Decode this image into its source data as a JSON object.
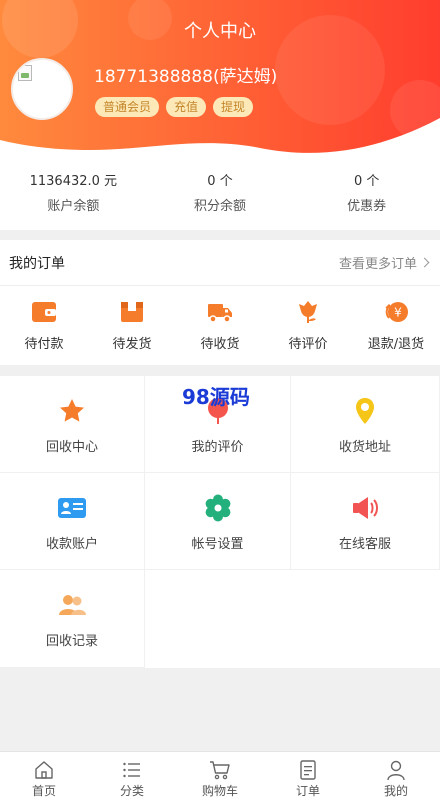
{
  "header": {
    "title": "个人中心",
    "username": "18771388888(萨达姆)",
    "badges": [
      {
        "label": "普通会员"
      },
      {
        "label": "充值"
      },
      {
        "label": "提现"
      }
    ],
    "colors": {
      "gradient_start": "#ff8a3d",
      "gradient_end": "#ff3d2e",
      "badge_bg": "#fde9b8",
      "badge_text": "#c4862a"
    }
  },
  "stats": [
    {
      "value": "1136432.0 元",
      "label": "账户余额"
    },
    {
      "value": "0 个",
      "label": "积分余额"
    },
    {
      "value": "0 个",
      "label": "优惠券"
    }
  ],
  "orders": {
    "title": "我的订单",
    "more": "查看更多订单",
    "items": [
      {
        "label": "待付款",
        "icon": "wallet-icon"
      },
      {
        "label": "待发货",
        "icon": "package-icon"
      },
      {
        "label": "待收货",
        "icon": "truck-icon"
      },
      {
        "label": "待评价",
        "icon": "flower-icon"
      },
      {
        "label": "退款/退货",
        "icon": "refund-icon"
      }
    ]
  },
  "watermark": "98源码",
  "services": [
    {
      "label": "回收中心",
      "icon": "star-icon",
      "color": "#f57c2b"
    },
    {
      "label": "我的评价",
      "icon": "review-icon",
      "color": "#f4564e"
    },
    {
      "label": "收货地址",
      "icon": "location-pin-icon",
      "color": "#f5c518"
    },
    {
      "label": "收款账户",
      "icon": "id-card-icon",
      "color": "#2e9af0"
    },
    {
      "label": "帐号设置",
      "icon": "gear-icon",
      "color": "#23b07d"
    },
    {
      "label": "在线客服",
      "icon": "speaker-icon",
      "color": "#f25454"
    },
    {
      "label": "回收记录",
      "icon": "users-icon",
      "color": "#f5a85a"
    }
  ],
  "tabbar": [
    {
      "label": "首页",
      "icon": "home-icon"
    },
    {
      "label": "分类",
      "icon": "list-icon"
    },
    {
      "label": "购物车",
      "icon": "cart-icon"
    },
    {
      "label": "订单",
      "icon": "order-doc-icon"
    },
    {
      "label": "我的",
      "icon": "user-icon"
    }
  ]
}
